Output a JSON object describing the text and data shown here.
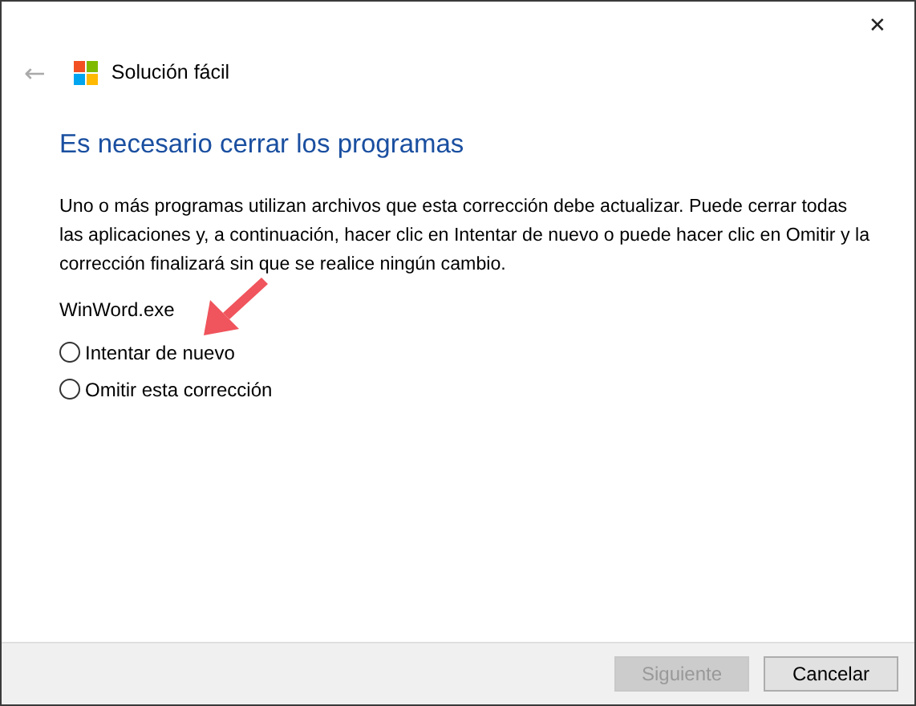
{
  "window": {
    "close": "✕"
  },
  "header": {
    "back": "←",
    "title": "Solución fácil",
    "back_disabled": true
  },
  "heading": "Es necesario cerrar los programas",
  "message": "Uno o más programas utilizan archivos que esta corrección debe actualizar. Puede cerrar todas las aplicaciones y, a continuación, hacer clic en Intentar de nuevo o puede hacer clic en Omitir y la corrección finalizará sin que se realice ningún cambio.",
  "program": "WinWord.exe",
  "options": [
    {
      "label": "Intentar de nuevo",
      "selected": false
    },
    {
      "label": "Omitir esta corrección",
      "selected": false
    }
  ],
  "buttons": [
    {
      "label": "Siguiente",
      "disabled": true
    },
    {
      "label": "Cancelar",
      "disabled": false
    }
  ]
}
